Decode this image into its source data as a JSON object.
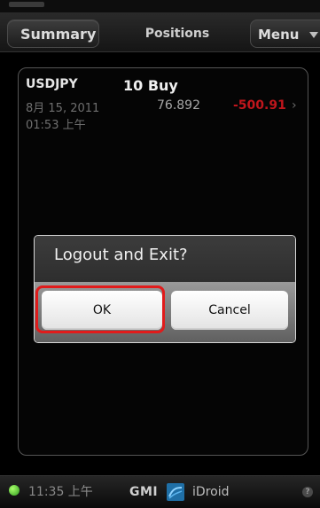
{
  "tabs": {
    "summary": "Summary",
    "positions": "Positions",
    "menu": "Menu"
  },
  "position": {
    "symbol": "USDJPY",
    "date": "8月 15, 2011",
    "time": "01:53 上午",
    "quantity": "10 Buy",
    "price": "76.892",
    "pl": "-500.91",
    "chevron": "›"
  },
  "dialog": {
    "title": "Logout and Exit?",
    "ok": "OK",
    "cancel": "Cancel"
  },
  "footer": {
    "time": "11:35 上午",
    "brand_gmi": "GMI",
    "brand_app": "iDroid",
    "help": "?"
  },
  "icons": {
    "menu": "chevron-down-icon",
    "connection": "connection-status-icon",
    "logo": "gmi-logo-icon",
    "help": "help-icon"
  },
  "colors": {
    "negative_pl": "#c0161c",
    "highlight": "#e11b1b",
    "connection_ok": "#2e9b1f"
  }
}
